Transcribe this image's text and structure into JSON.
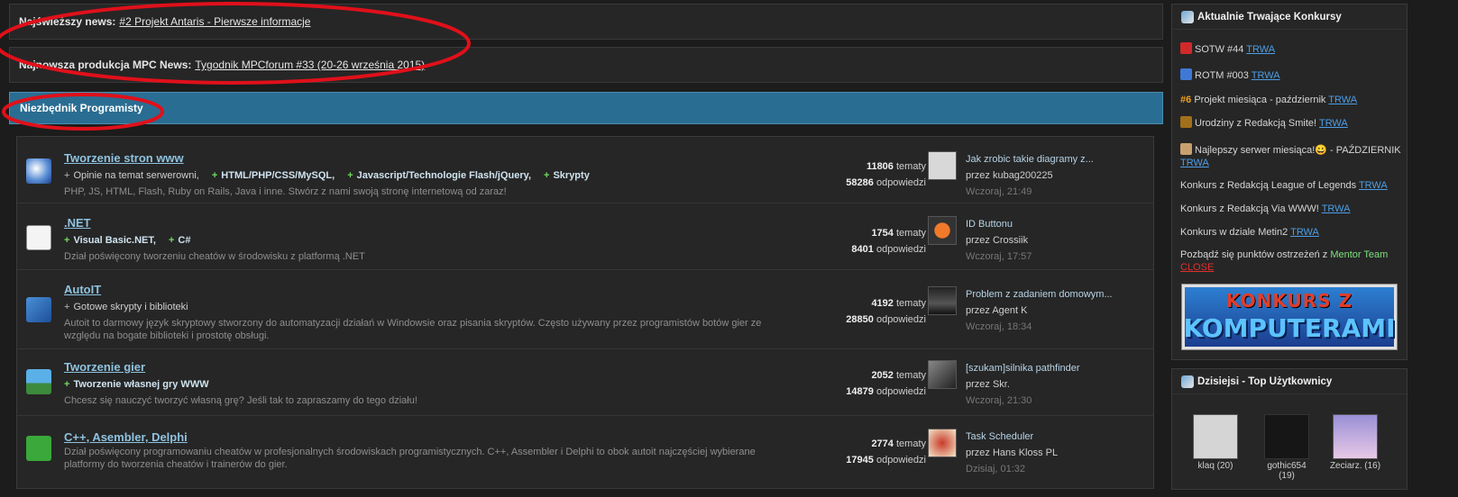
{
  "news": {
    "label": "Najświeższy news:",
    "link": "#2 Projekt Antaris - Pierwsze informacje"
  },
  "production": {
    "label": "Najnowsza produkcja MPC News:",
    "link": "Tygodnik MPCforum #33 (20-26 września 2015)"
  },
  "category": {
    "title": "Niezbędnik Programisty"
  },
  "forums": [
    {
      "title": "Tworzenie stron www",
      "subs": [
        "Opinie na temat serwerowni,",
        "HTML/PHP/CSS/MySQL,",
        "Javascript/Technologie Flash/jQuery,",
        "Skrypty"
      ],
      "desc": "PHP, JS, HTML, Flash, Ruby on Rails, Java i inne. Stwórz z nami swoją stronę internetową od zaraz!",
      "topics": "11806",
      "topics_label": "tematy",
      "replies": "58286",
      "replies_label": "odpowiedzi",
      "last_title": "Jak zrobic takie diagramy z...",
      "last_by": "przez kubag200225",
      "last_date": "Wczoraj, 21:49",
      "icon": "globe-icon"
    },
    {
      "title": ".NET",
      "subs": [
        "Visual Basic.NET,",
        "C#"
      ],
      "desc": "Dział poświęcony tworzeniu cheatów w środowisku z platformą .NET",
      "topics": "1754",
      "topics_label": "tematy",
      "replies": "8401",
      "replies_label": "odpowiedzi",
      "last_title": "ID Buttonu",
      "last_by": "przez Crossiik",
      "last_date": "Wczoraj, 17:57",
      "icon": "dotnet-icon"
    },
    {
      "title": "AutoIT",
      "subs": [
        "Gotowe skrypty i biblioteki"
      ],
      "desc": "Autoit to darmowy język skryptowy stworzony do automatyzacji działań w Windowsie oraz pisania skryptów. Często używany przez programistów botów gier ze względu na bogate biblioteki i prostotę obsługi.",
      "topics": "4192",
      "topics_label": "tematy",
      "replies": "28850",
      "replies_label": "odpowiedzi",
      "last_title": "Problem z zadaniem domowym...",
      "last_by": "przez Agent K",
      "last_date": "Wczoraj, 18:34",
      "icon": "autoit-icon"
    },
    {
      "title": "Tworzenie gier",
      "subs": [
        "Tworzenie własnej gry WWW"
      ],
      "desc": "Chcesz się nauczyć tworzyć własną grę? Jeśli tak to zapraszamy do tego działu!",
      "topics": "2052",
      "topics_label": "tematy",
      "replies": "14879",
      "replies_label": "odpowiedzi",
      "last_title": "[szukam]silnika pathfinder",
      "last_by": "przez Skr.",
      "last_date": "Wczoraj, 21:30",
      "icon": "game-icon"
    },
    {
      "title": "C++, Asembler, Delphi",
      "subs": [],
      "desc": "Dział poświęcony programowaniu cheatów w profesjonalnych środowiskach programistycznych. C++, Assembler i Delphi to obok autoit najczęściej wybierane platformy do tworzenia cheatów i trainerów do gier.",
      "topics": "2774",
      "topics_label": "tematy",
      "replies": "17945",
      "replies_label": "odpowiedzi",
      "last_title": "Task Scheduler",
      "last_by": "przez Hans Kloss PL",
      "last_date": "Dzisiaj, 01:32",
      "icon": "cpp-icon"
    }
  ],
  "contests": {
    "title": "Aktualnie Trwające Konkursy",
    "status": "TRWA",
    "items": [
      "SOTW #44",
      "ROTM #003",
      "Projekt miesiąca - październik",
      "Urodziny z Redakcją Smite!",
      "Najlepszy serwer miesiąca!😀 - PAŹDZIERNIK",
      "Konkurs z Redakcją League of Legends",
      "Konkurs z Redakcją Via WWW!",
      "Konkurs w dziale Metin2"
    ],
    "six": "#6",
    "warning": "Pozbądź się punktów ostrzeżeń z",
    "mentor": "Mentor Team",
    "close": "CLOSE",
    "banner_line1": "KONKURS Z",
    "banner_line2": "KOMPUTERAMI"
  },
  "top_users": {
    "title": "Dzisiejsi - Top Użytkownicy",
    "users": [
      {
        "name": "klaq (20)"
      },
      {
        "name": "gothic654 (19)"
      },
      {
        "name": "Zeciarz. (16)"
      }
    ]
  },
  "colors": {
    "accent": "#2a6d92",
    "link_blue": "#4d9ee6",
    "plus_green": "#6fdc5b",
    "annotation_red": "#e0101a"
  }
}
